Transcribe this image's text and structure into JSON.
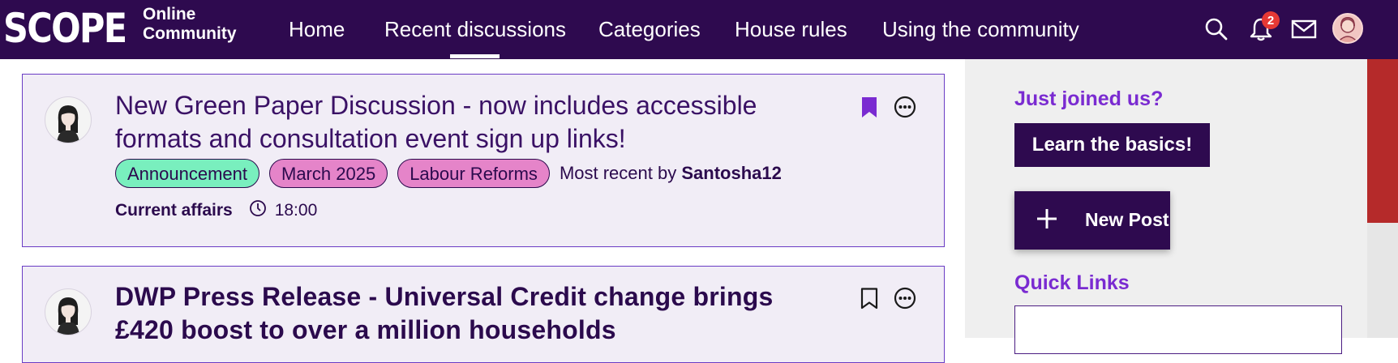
{
  "header": {
    "logo_word": "SCOPE",
    "logo_sub_line1": "Online",
    "logo_sub_line2": "Community",
    "nav": [
      "Home",
      "Recent discussions",
      "Categories",
      "House rules",
      "Using the community"
    ],
    "active_nav": "Recent discussions",
    "notification_count": "2",
    "icons": [
      "search-icon",
      "bell-icon",
      "mail-icon",
      "avatar"
    ]
  },
  "discussions": [
    {
      "title": "New Green Paper Discussion - now includes accessible formats and consultation event sign up links!",
      "tags": [
        "Announcement",
        "March 2025",
        "Labour Reforms"
      ],
      "most_recent_prefix": "Most recent by",
      "most_recent_user": "Santosha12",
      "category": "Current affairs",
      "time": "18:00",
      "bookmarked": true
    },
    {
      "title": "DWP Press Release - Universal Credit change brings £420 boost to over a million households",
      "bookmarked": false
    }
  ],
  "sidebar": {
    "just_joined": "Just joined us?",
    "learn_basics": "Learn the basics!",
    "new_post": "New Post",
    "quick_links": "Quick Links"
  },
  "colors": {
    "header_bg": "#2e0a4f",
    "accent_purple": "#7a2bd1",
    "tag_green": "#79efbe",
    "tag_pink": "#e584c9",
    "badge_red": "#e53935",
    "scroll_thumb": "#b52a2a"
  }
}
